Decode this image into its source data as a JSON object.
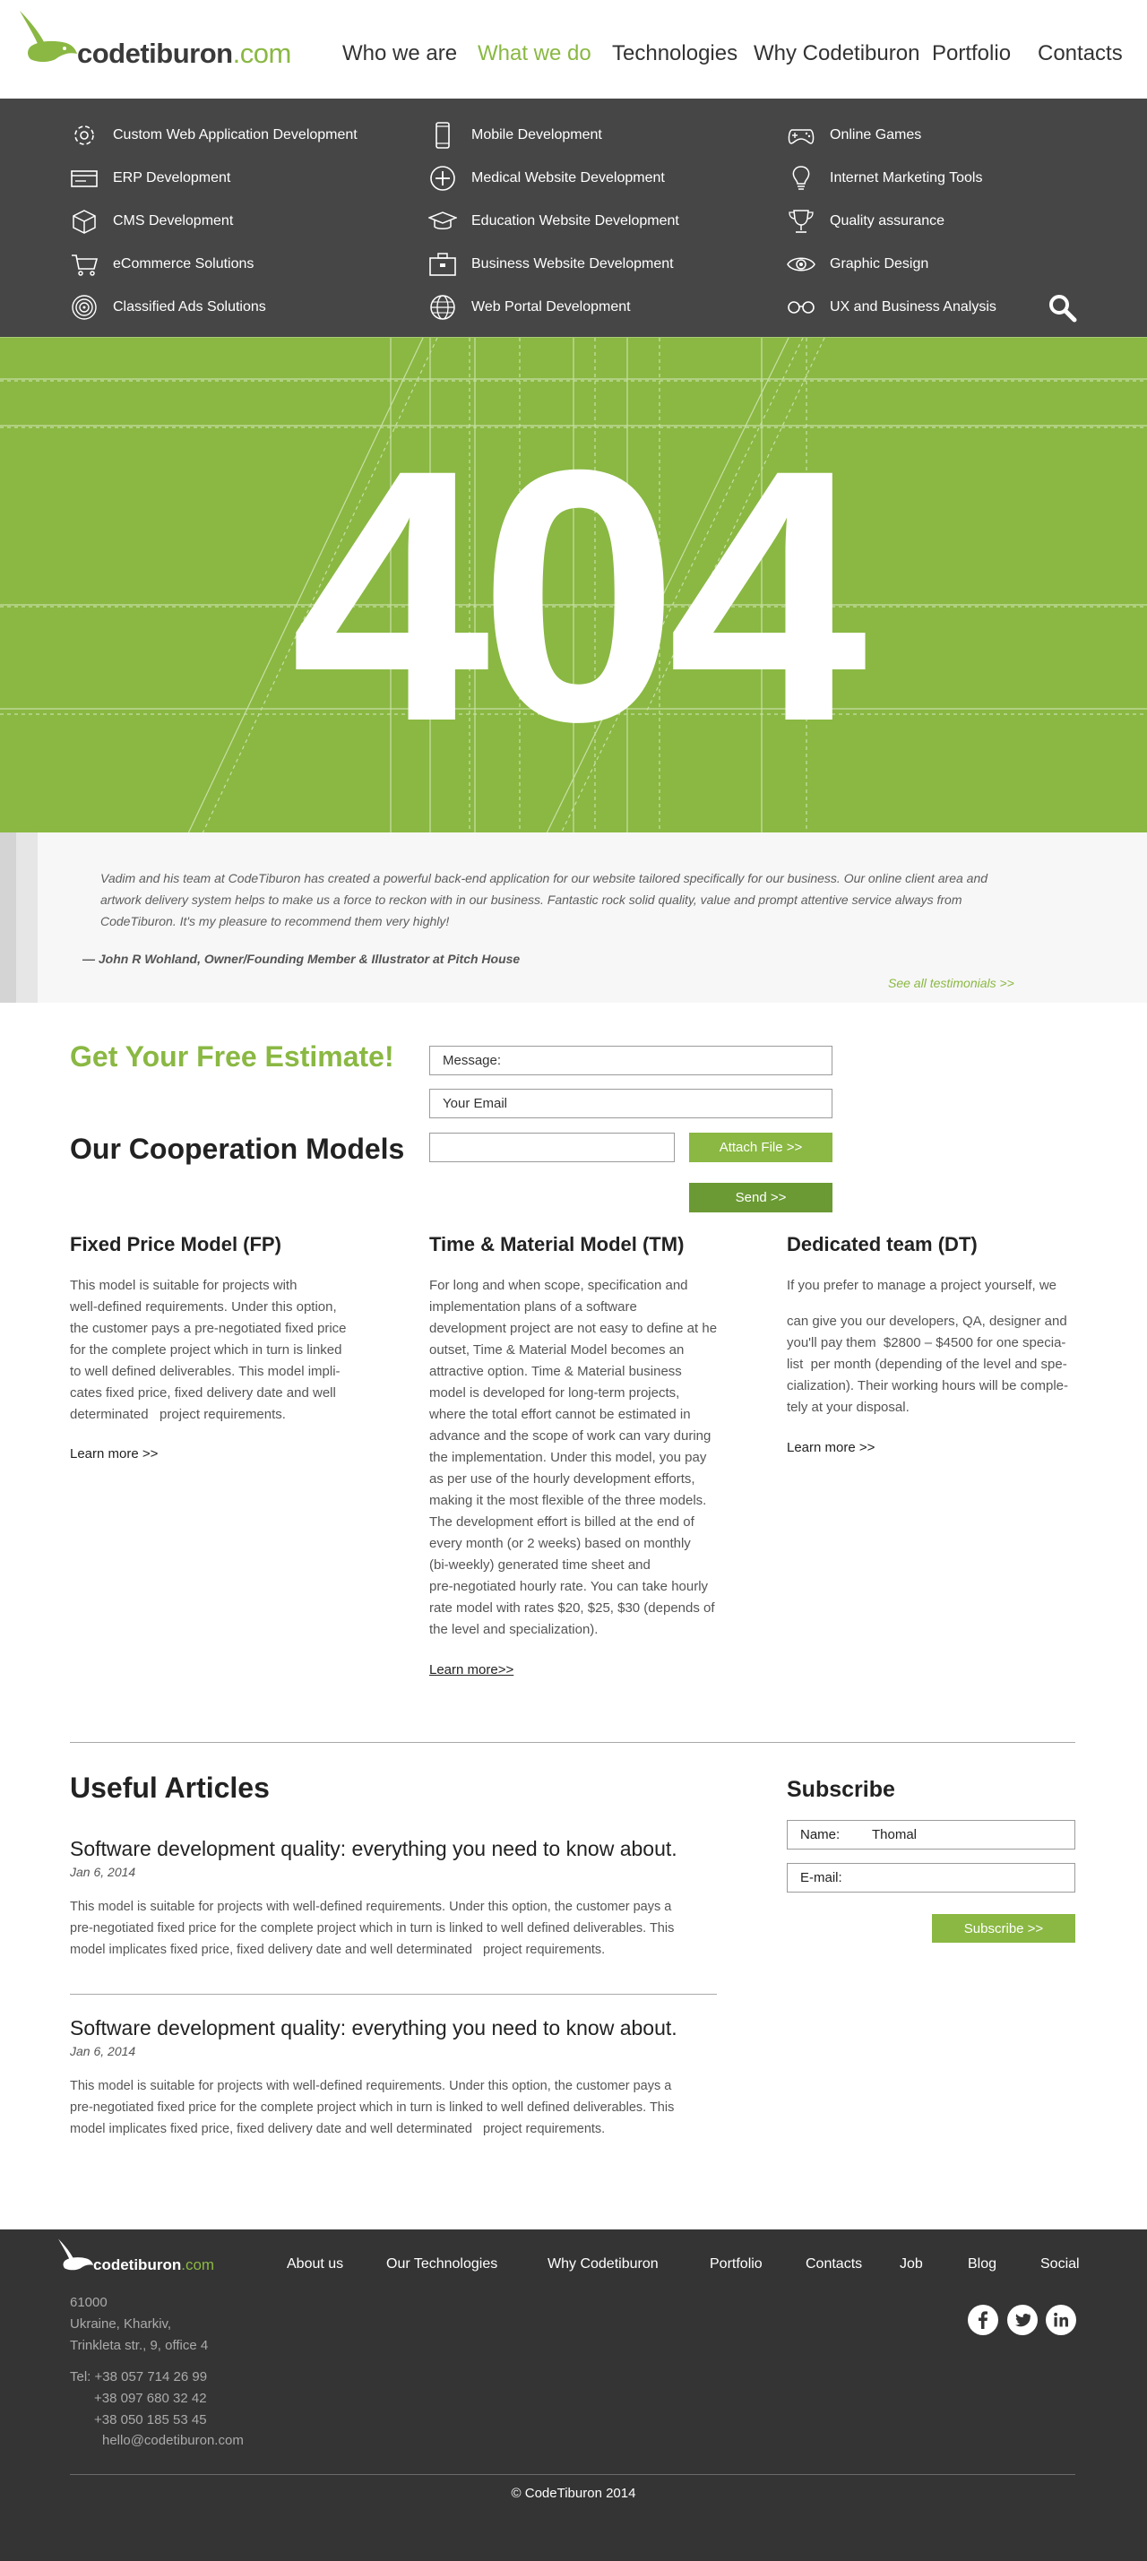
{
  "brand": {
    "name": "codetiburon",
    "tld": ".com",
    "accent": "#8ab843",
    "dark": "#464646"
  },
  "nav": [
    {
      "label": "Who we are",
      "active": false
    },
    {
      "label": "What we do",
      "active": true
    },
    {
      "label": "Technologies",
      "active": false
    },
    {
      "label": "Why Codetiburon",
      "active": false
    },
    {
      "label": "Portfolio",
      "active": false
    },
    {
      "label": "Contacts",
      "active": false
    }
  ],
  "services": [
    {
      "label": "Custom Web Application Development",
      "icon": "gear-icon"
    },
    {
      "label": "ERP Development",
      "icon": "card-icon"
    },
    {
      "label": "CMS Development",
      "icon": "cube-icon"
    },
    {
      "label": "eCommerce Solutions",
      "icon": "cart-icon"
    },
    {
      "label": "Classified Ads Solutions",
      "icon": "target-icon"
    },
    {
      "label": "Mobile Development",
      "icon": "phone-icon"
    },
    {
      "label": "Medical Website Development",
      "icon": "plus-circle-icon"
    },
    {
      "label": "Education Website Development",
      "icon": "graduation-cap-icon"
    },
    {
      "label": "Business Website Development",
      "icon": "briefcase-icon"
    },
    {
      "label": "Web Portal Development",
      "icon": "globe-icon"
    },
    {
      "label": "Online Games",
      "icon": "gamepad-icon"
    },
    {
      "label": "Internet Marketing Tools",
      "icon": "lightbulb-icon"
    },
    {
      "label": "Quality assurance",
      "icon": "trophy-icon"
    },
    {
      "label": "Graphic Design",
      "icon": "eye-icon"
    },
    {
      "label": "UX and Business Analysis",
      "icon": "glasses-icon"
    }
  ],
  "hero": {
    "code": "404"
  },
  "testimonial": {
    "quote": "Vadim and his team at CodeTiburon has created a powerful back-end application for our website tailored specifically for our business. Our online client area and artwork delivery system helps to make us a force to reckon with in our business. Fantastic rock solid quality, value and prompt attentive service always from CodeTiburon. It's my pleasure to recommend them very highly!",
    "author": "— John R Wohland, Owner/Founding Member & Illustrator at Pitch House",
    "link": "See all testimonials >>"
  },
  "estimate": {
    "title": "Get Your Free Estimate!",
    "message_placeholder": "Message:",
    "email_placeholder": "Your Email",
    "attach_label": "Attach File >>",
    "send_label": "Send >>"
  },
  "cooperation": {
    "title": "Our Cooperation Models",
    "models": [
      {
        "title": "Fixed Price Model (FP)",
        "lines": [
          "This model is suitable for projects with",
          "well-defined requirements. Under this option,",
          "the customer pays a pre-negotiated fixed price",
          "for the complete project which in turn is linked",
          "to well defined deliverables. This model impli-",
          "cates fixed price, fixed delivery date and well",
          "determinated   project requirements."
        ],
        "learn": "Learn more >>"
      },
      {
        "title": "Time & Material Model (TM)",
        "lines": [
          "For long and when scope, specification and",
          "implementation plans of a software",
          "development project are not easy to define at he",
          "outset, Time & Material Model becomes an",
          "attractive option. Time & Material business",
          "model is developed for long-term projects,",
          "where the total effort cannot be estimated in",
          "advance and the scope of work can vary during",
          "the implementation. Under this model, you pay",
          "as per use of the hourly development efforts,",
          "making it the most flexible of the three models.",
          "The development effort is billed at the end of",
          "every month (or 2 weeks) based on monthly",
          "(bi-weekly) generated time sheet and",
          "pre-negotiated hourly rate. You can take hourly",
          "rate model with rates $20, $25, $30 (depends of",
          "the level and specialization)."
        ],
        "learn": "Learn more>>"
      },
      {
        "title": "Dedicated team (DT)",
        "intro": "If you prefer to manage a project yourself, we",
        "lines": [
          "can give you our developers, QA, designer and",
          "you'll pay them  $2800 – $4500 for one specia-",
          "list  per month (depending of the level and spe-",
          "cialization). Their working hours will be comple-",
          "tely at your disposal."
        ],
        "learn": "Learn more >>"
      }
    ]
  },
  "articles": {
    "title": "Useful Articles",
    "items": [
      {
        "title": "Software development quality: everything you need to know about.",
        "date": "Jan 6, 2014",
        "lines": [
          "This model is suitable for projects with well-defined requirements. Under this option, the customer pays a",
          "pre-negotiated fixed price for the complete project which in turn is linked to well defined deliverables. This",
          "model implicates fixed price, fixed delivery date and well determinated   project requirements."
        ]
      },
      {
        "title": "Software development quality: everything you need to know about.",
        "date": "Jan 6, 2014",
        "lines": [
          "This model is suitable for projects with well-defined requirements. Under this option, the customer pays a",
          "pre-negotiated fixed price for the complete project which in turn is linked to well defined deliverables. This",
          "model implicates fixed price, fixed delivery date and well determinated   project requirements."
        ]
      }
    ]
  },
  "subscribe": {
    "title": "Subscribe",
    "name_label": "Name:",
    "name_value": "Thomal",
    "email_label": "E-mail:",
    "email_value": "",
    "button": "Subscribe >>"
  },
  "footer": {
    "nav": [
      "About us",
      "Our Technologies",
      "Why Codetiburon",
      "Portfolio",
      "Contacts",
      "Job",
      "Blog",
      "Social"
    ],
    "address": [
      "61000",
      "Ukraine, Kharkiv,",
      "Trinkleta str., 9, office 4"
    ],
    "phones": [
      "Tel: +38 057 714 26 99",
      "+38 097 680 32 42",
      "+38 050 185 53 45"
    ],
    "email": "hello@codetiburon.com",
    "social": [
      "facebook-icon",
      "twitter-icon",
      "linkedin-icon"
    ],
    "copyright": "© CodeTiburon 2014"
  }
}
